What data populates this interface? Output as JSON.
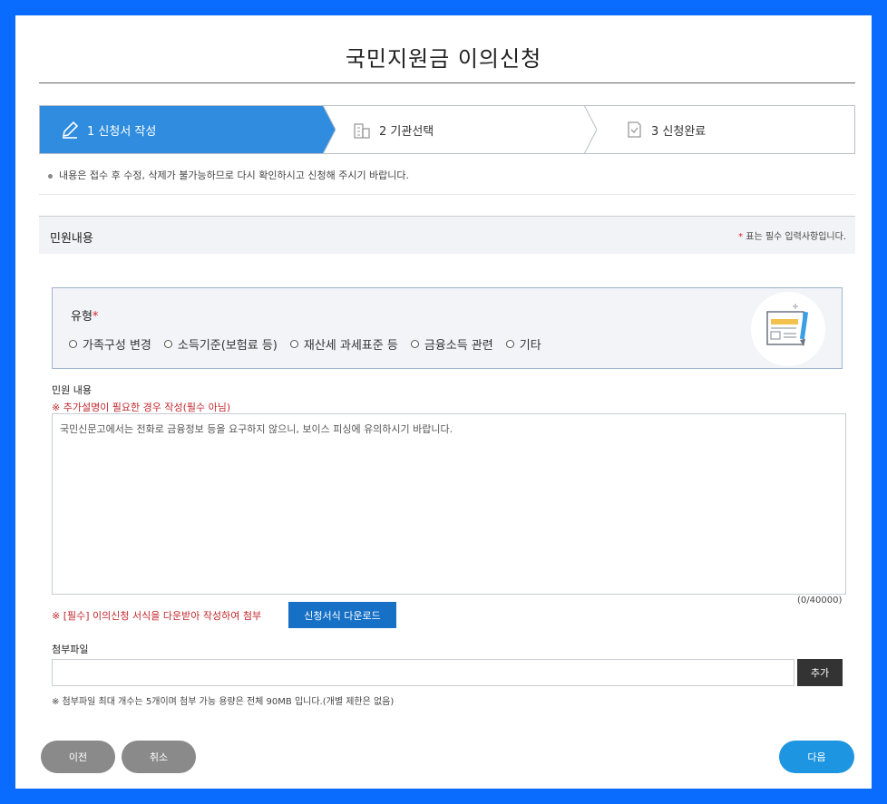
{
  "page": {
    "title": "국민지원금 이의신청"
  },
  "steps": [
    {
      "label": "1 신청서 작성",
      "icon": "pencil-icon"
    },
    {
      "label": "2 기관선택",
      "icon": "building-icon"
    },
    {
      "label": "3 신청완료",
      "icon": "check-document-icon"
    }
  ],
  "notice": "내용은 접수 후 수정, 삭제가 불가능하므로 다시 확인하시고 신청해 주시기 바랍니다.",
  "section": {
    "title": "민원내용",
    "required_mark": "*",
    "required_text": " 표는 필수 입력사항입니다."
  },
  "type_field": {
    "label": "유형",
    "required_mark": "*",
    "options": [
      "가족구성 변경",
      "소득기준(보험료 등)",
      "재산세 과세표준 등",
      "금융소득 관련",
      "기타"
    ]
  },
  "complaint": {
    "label": "민원 내용",
    "hint": "※ 추가설명이 필요한 경우 작성(필수 아님)",
    "placeholder": "국민신문고에서는 전화로 금융정보 등을 요구하지 않으니, 보이스 피싱에 유의하시기 바랍니다.",
    "counter": "(0/40000)"
  },
  "form_download": {
    "note": "※ [필수] 이의신청 서식을 다운받아 작성하여 첨부",
    "button": "신청서식 다운로드"
  },
  "attachment": {
    "label": "첨부파일",
    "value": "",
    "add_button": "추가",
    "note": "※ 첨부파일 최대 개수는 5개이며 첨부 가능 용량은 전체 90MB 입니다.(개별 제한은 없음)"
  },
  "buttons": {
    "prev": "이전",
    "cancel": "취소",
    "next": "다음"
  },
  "colors": {
    "frame": "#0a6cff",
    "active_step": "#2f8cde",
    "primary_button": "#1670c6",
    "next_button": "#1e95e0",
    "alert_text": "#c0272d"
  }
}
